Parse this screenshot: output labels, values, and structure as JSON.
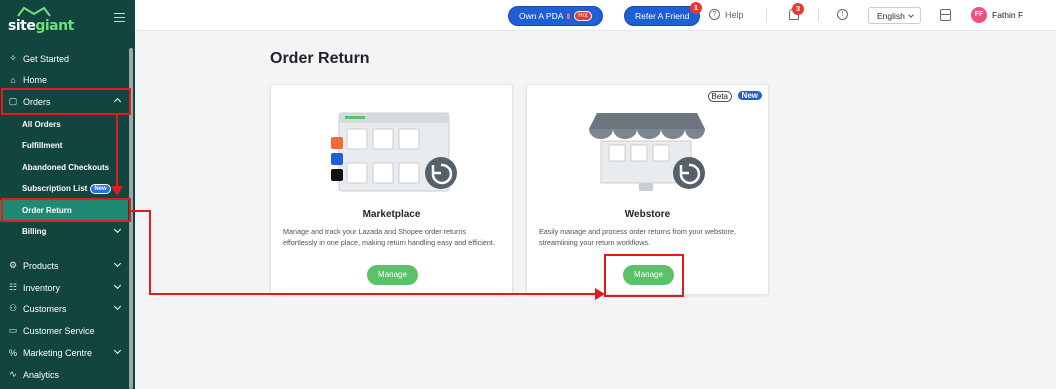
{
  "brand": {
    "part1": "site",
    "part2": "giant"
  },
  "sidebar": {
    "items": [
      {
        "label": "Get Started",
        "icon": "sparkle-icon",
        "glyph": "✧"
      },
      {
        "label": "Home",
        "icon": "home-icon",
        "glyph": "⌂"
      },
      {
        "label": "Orders",
        "icon": "clipboard-icon",
        "glyph": "▢"
      }
    ],
    "order_subitems": [
      "All Orders",
      "Fulfillment",
      "Abandoned Checkouts",
      "Subscription List",
      "Order Return"
    ],
    "new_badge": "New",
    "billing": "Billing",
    "sections": [
      {
        "label": "Products",
        "icon": "products-icon",
        "glyph": "⚙"
      },
      {
        "label": "Inventory",
        "icon": "inventory-icon",
        "glyph": "☷"
      },
      {
        "label": "Customers",
        "icon": "customers-icon",
        "glyph": "⚇"
      },
      {
        "label": "Customer Service",
        "icon": "chat-icon",
        "glyph": "▭"
      },
      {
        "label": "Marketing Centre",
        "icon": "percent-icon",
        "glyph": "%"
      },
      {
        "label": "Analytics",
        "icon": "analytics-icon",
        "glyph": "∿"
      }
    ]
  },
  "topbar": {
    "own_pda": "Own A PDA",
    "hot": "Hot",
    "refer": "Refer A Friend",
    "refer_badge": "1",
    "help": "Help",
    "notif_count": "3",
    "language": "English",
    "avatar_initials": "FF",
    "user_name": "Fathin F"
  },
  "main": {
    "title": "Order Return",
    "cards": [
      {
        "title": "Marketplace",
        "desc": "Manage and track your Lazada and Shopee order returns effortlessly in one place, making return handling easy and efficient.",
        "button": "Manage"
      },
      {
        "title": "Webstore",
        "desc": "Easily manage and process order returns from your webstore, streamlining your return workflows.",
        "button": "Manage",
        "beta": "Beta",
        "new": "New"
      }
    ]
  },
  "colors": {
    "sidebar": "#12453f",
    "active": "#1f8a74",
    "primary": "#1f5fd6",
    "manage": "#5cc269",
    "annotation": "#e41b1b"
  }
}
